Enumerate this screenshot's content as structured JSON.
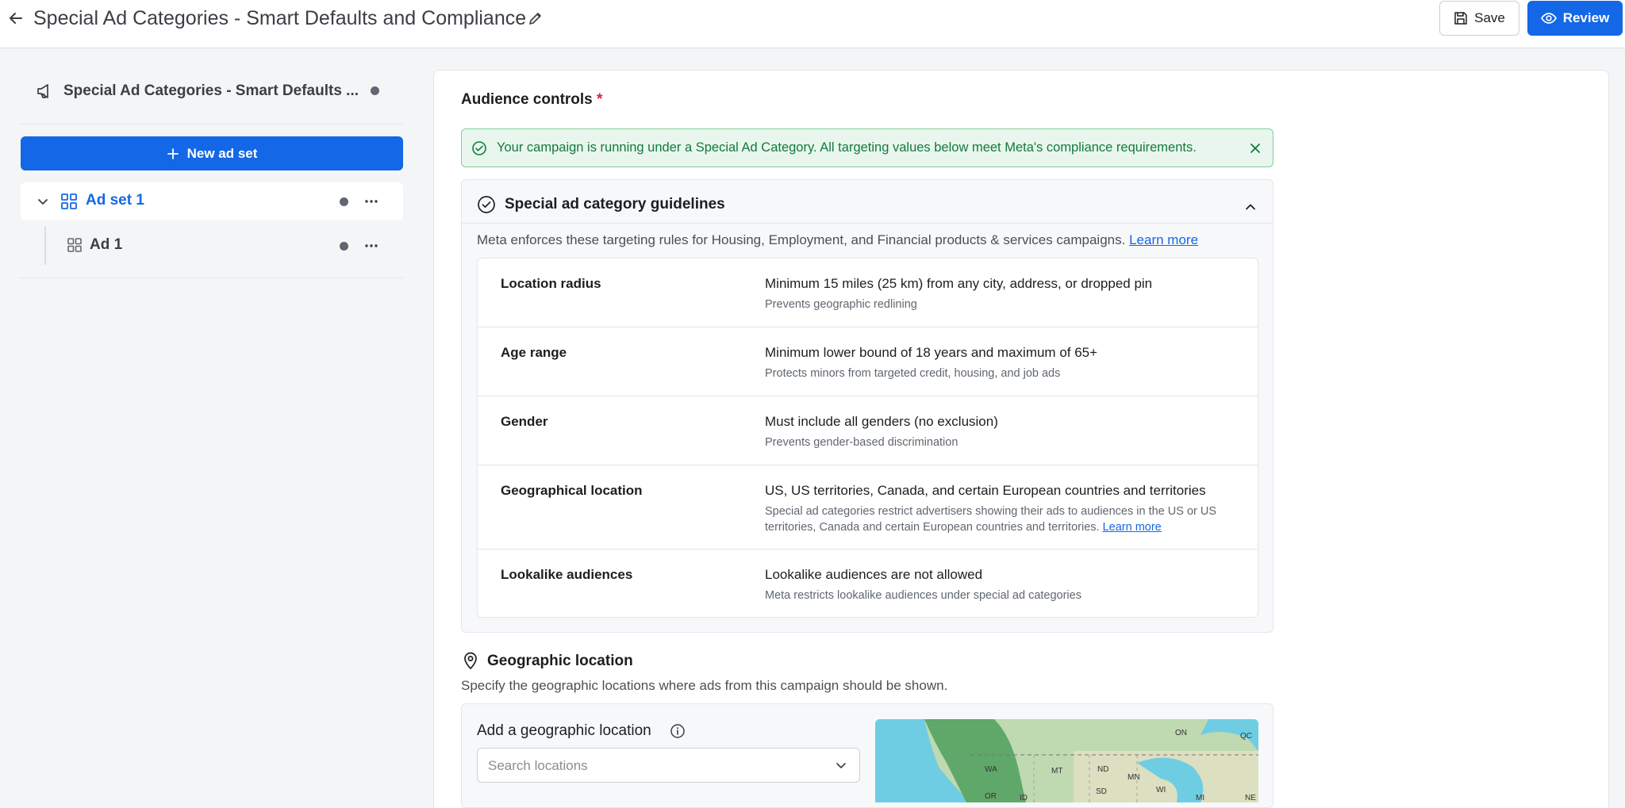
{
  "header": {
    "title": "Special Ad Categories - Smart Defaults and Compliance",
    "save_label": "Save",
    "review_label": "Review"
  },
  "sidebar": {
    "campaign_name": "Special Ad Categories - Smart Defaults ...",
    "new_adset_label": "New ad set",
    "adset_label": "Ad set 1",
    "ad_label": "Ad 1"
  },
  "main": {
    "section_title": "Audience controls",
    "required_mark": "*",
    "alert_message": "Your campaign is running under a Special Ad Category. All targeting values below meet Meta's compliance requirements.",
    "guidelines": {
      "title": "Special ad category guidelines",
      "description": "Meta enforces these targeting rules for Housing, Employment, and Financial products & services campaigns.",
      "learn_more": "Learn more",
      "rules": [
        {
          "name": "Location radius",
          "value": "Minimum 15 miles (25 km) from any city, address, or dropped pin",
          "sub": "Prevents geographic redlining"
        },
        {
          "name": "Age range",
          "value": "Minimum lower bound of 18 years and maximum of 65+",
          "sub": "Protects minors from targeted credit, housing, and job ads"
        },
        {
          "name": "Gender",
          "value": "Must include all genders (no exclusion)",
          "sub": "Prevents gender-based discrimination"
        },
        {
          "name": "Geographical location",
          "value": "US, US territories, Canada, and certain European countries and territories",
          "sub": "Special ad categories restrict advertisers showing their ads to audiences in the US or US territories, Canada and certain European countries and territories.",
          "sub_link": "Learn more"
        },
        {
          "name": "Lookalike audiences",
          "value": "Lookalike audiences are not allowed",
          "sub": "Meta restricts lookalike audiences under special ad categories"
        }
      ]
    },
    "geo": {
      "title": "Geographic location",
      "description": "Specify the geographic locations where ads from this campaign should be shown.",
      "add_label": "Add a geographic location",
      "search_placeholder": "Search locations",
      "map_labels": [
        "ON",
        "QC",
        "WA",
        "MT",
        "ND",
        "MN",
        "OR",
        "ID",
        "SD",
        "WI",
        "MI",
        "NE"
      ]
    }
  },
  "colors": {
    "accent": "#1467e6",
    "success_text": "#157a3e",
    "success_bg": "#e8f6ed",
    "required": "#e41e3f"
  }
}
